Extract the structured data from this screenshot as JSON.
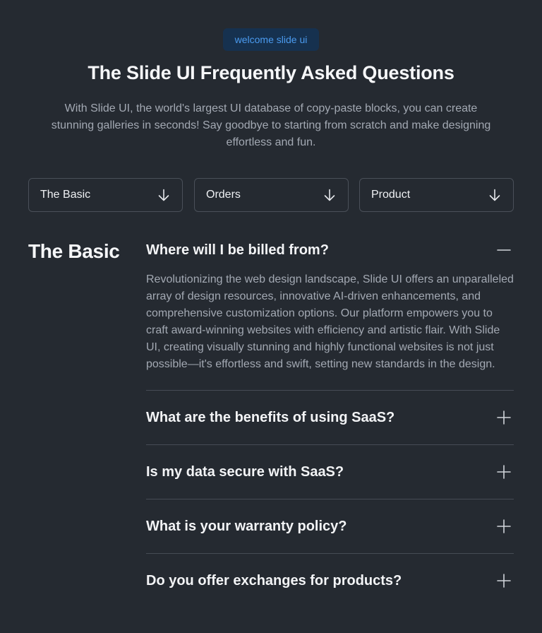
{
  "badge": "welcome slide ui",
  "title": "The Slide UI Frequently Asked Questions",
  "subtitle": "With Slide UI, the world's largest UI database of copy-paste blocks, you can create stunning galleries in seconds! Say goodbye to starting from scratch and make designing effortless and fun.",
  "filters": [
    {
      "label": "The Basic",
      "icon": "arrow-down-icon"
    },
    {
      "label": "Orders",
      "icon": "arrow-down-icon"
    },
    {
      "label": "Product",
      "icon": "arrow-down-icon"
    }
  ],
  "section_title": "The Basic",
  "faq": [
    {
      "question": "Where will I be billed from?",
      "answer": "Revolutionizing the web design landscape, Slide UI offers an unparalleled array of design resources, innovative AI-driven enhancements, and comprehensive customization options. Our platform empowers you to craft award-winning websites with efficiency and artistic flair. With Slide UI, creating visually stunning and highly functional websites is not just possible—it's effortless and swift, setting new standards in the design.",
      "icon": "minus-icon"
    },
    {
      "question": "What are the benefits of using SaaS?",
      "icon": "plus-icon"
    },
    {
      "question": "Is my data secure with SaaS?",
      "icon": "plus-icon"
    },
    {
      "question": "What is your warranty policy?",
      "icon": "plus-icon"
    },
    {
      "question": "Do you offer exchanges for products?",
      "icon": "plus-icon"
    }
  ],
  "colors": {
    "background": "#252a31",
    "badge_bg": "#16314f",
    "badge_text": "#4b9bf0",
    "muted_text": "#a3a9b3",
    "border": "#4a5059"
  }
}
